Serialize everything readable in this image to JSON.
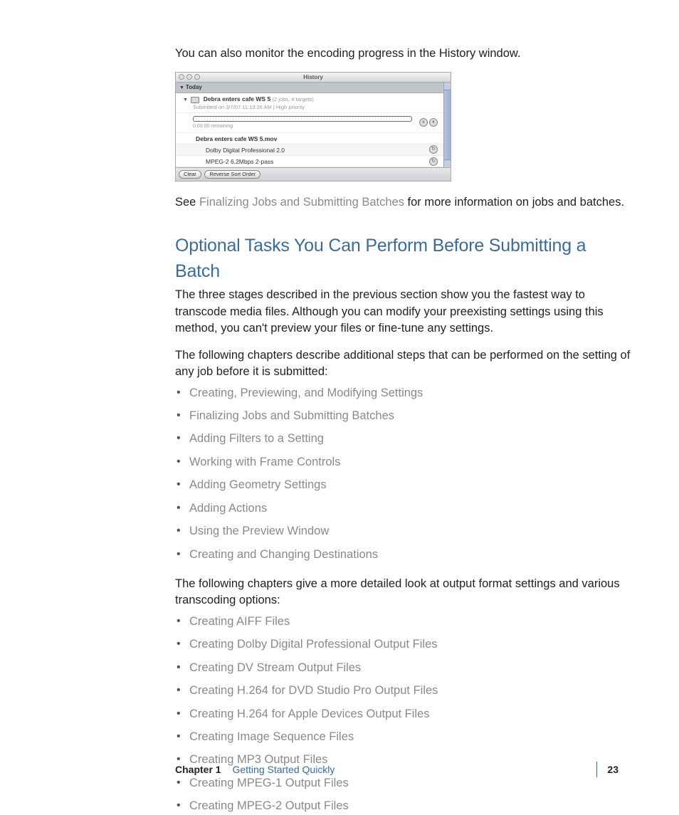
{
  "intro_para": "You can also monitor the encoding progress in the History window.",
  "see_line": {
    "prefix": "See ",
    "link": "Finalizing Jobs and Submitting Batches",
    "suffix": " for more information on jobs and batches."
  },
  "heading": "Optional Tasks You Can Perform Before Submitting a Batch",
  "para_after_heading": "The three stages described in the previous section show you the fastest way to transcode media files. Although you can modify your preexisting settings using this method, you can't preview your files or fine-tune any settings.",
  "para_list1": "The following chapters describe additional steps that can be performed on the setting of any job before it is submitted:",
  "list1": [
    "Creating, Previewing, and Modifying Settings",
    "Finalizing Jobs and Submitting Batches",
    "Adding Filters to a Setting",
    "Working with Frame Controls",
    "Adding Geometry Settings",
    "Adding Actions",
    "Using the Preview Window",
    "Creating and Changing Destinations"
  ],
  "para_list2": "The following chapters give a more detailed look at output format settings and various transcoding options:",
  "list2": [
    "Creating AIFF Files",
    "Creating Dolby Digital Professional Output Files",
    "Creating DV Stream Output Files",
    "Creating H.264 for DVD Studio Pro Output Files",
    "Creating H.264 for Apple Devices Output Files",
    "Creating Image Sequence Files",
    "Creating MP3 Output Files",
    "Creating MPEG-1 Output Files",
    "Creating MPEG-2 Output Files"
  ],
  "history_window": {
    "title": "History",
    "today_label": "Today",
    "batch_name": "Debra enters cafe WS 5",
    "batch_meta": "(2 jobs, 4 targets)",
    "submitted": "Submitted on 3/7/07 11:13:26 AM  |  High priority",
    "remaining": "0:00:00 remaining",
    "job_name": "Debra enters cafe WS 5.mov",
    "target1": "Dolby Digital Professional 2.0",
    "target2": "MPEG-2 6.2Mbps 2-pass",
    "btn_clear": "Clear",
    "btn_reverse": "Reverse Sort Order"
  },
  "footer": {
    "chapter_label": "Chapter 1",
    "chapter_title": "Getting Started Quickly",
    "page_number": "23"
  }
}
